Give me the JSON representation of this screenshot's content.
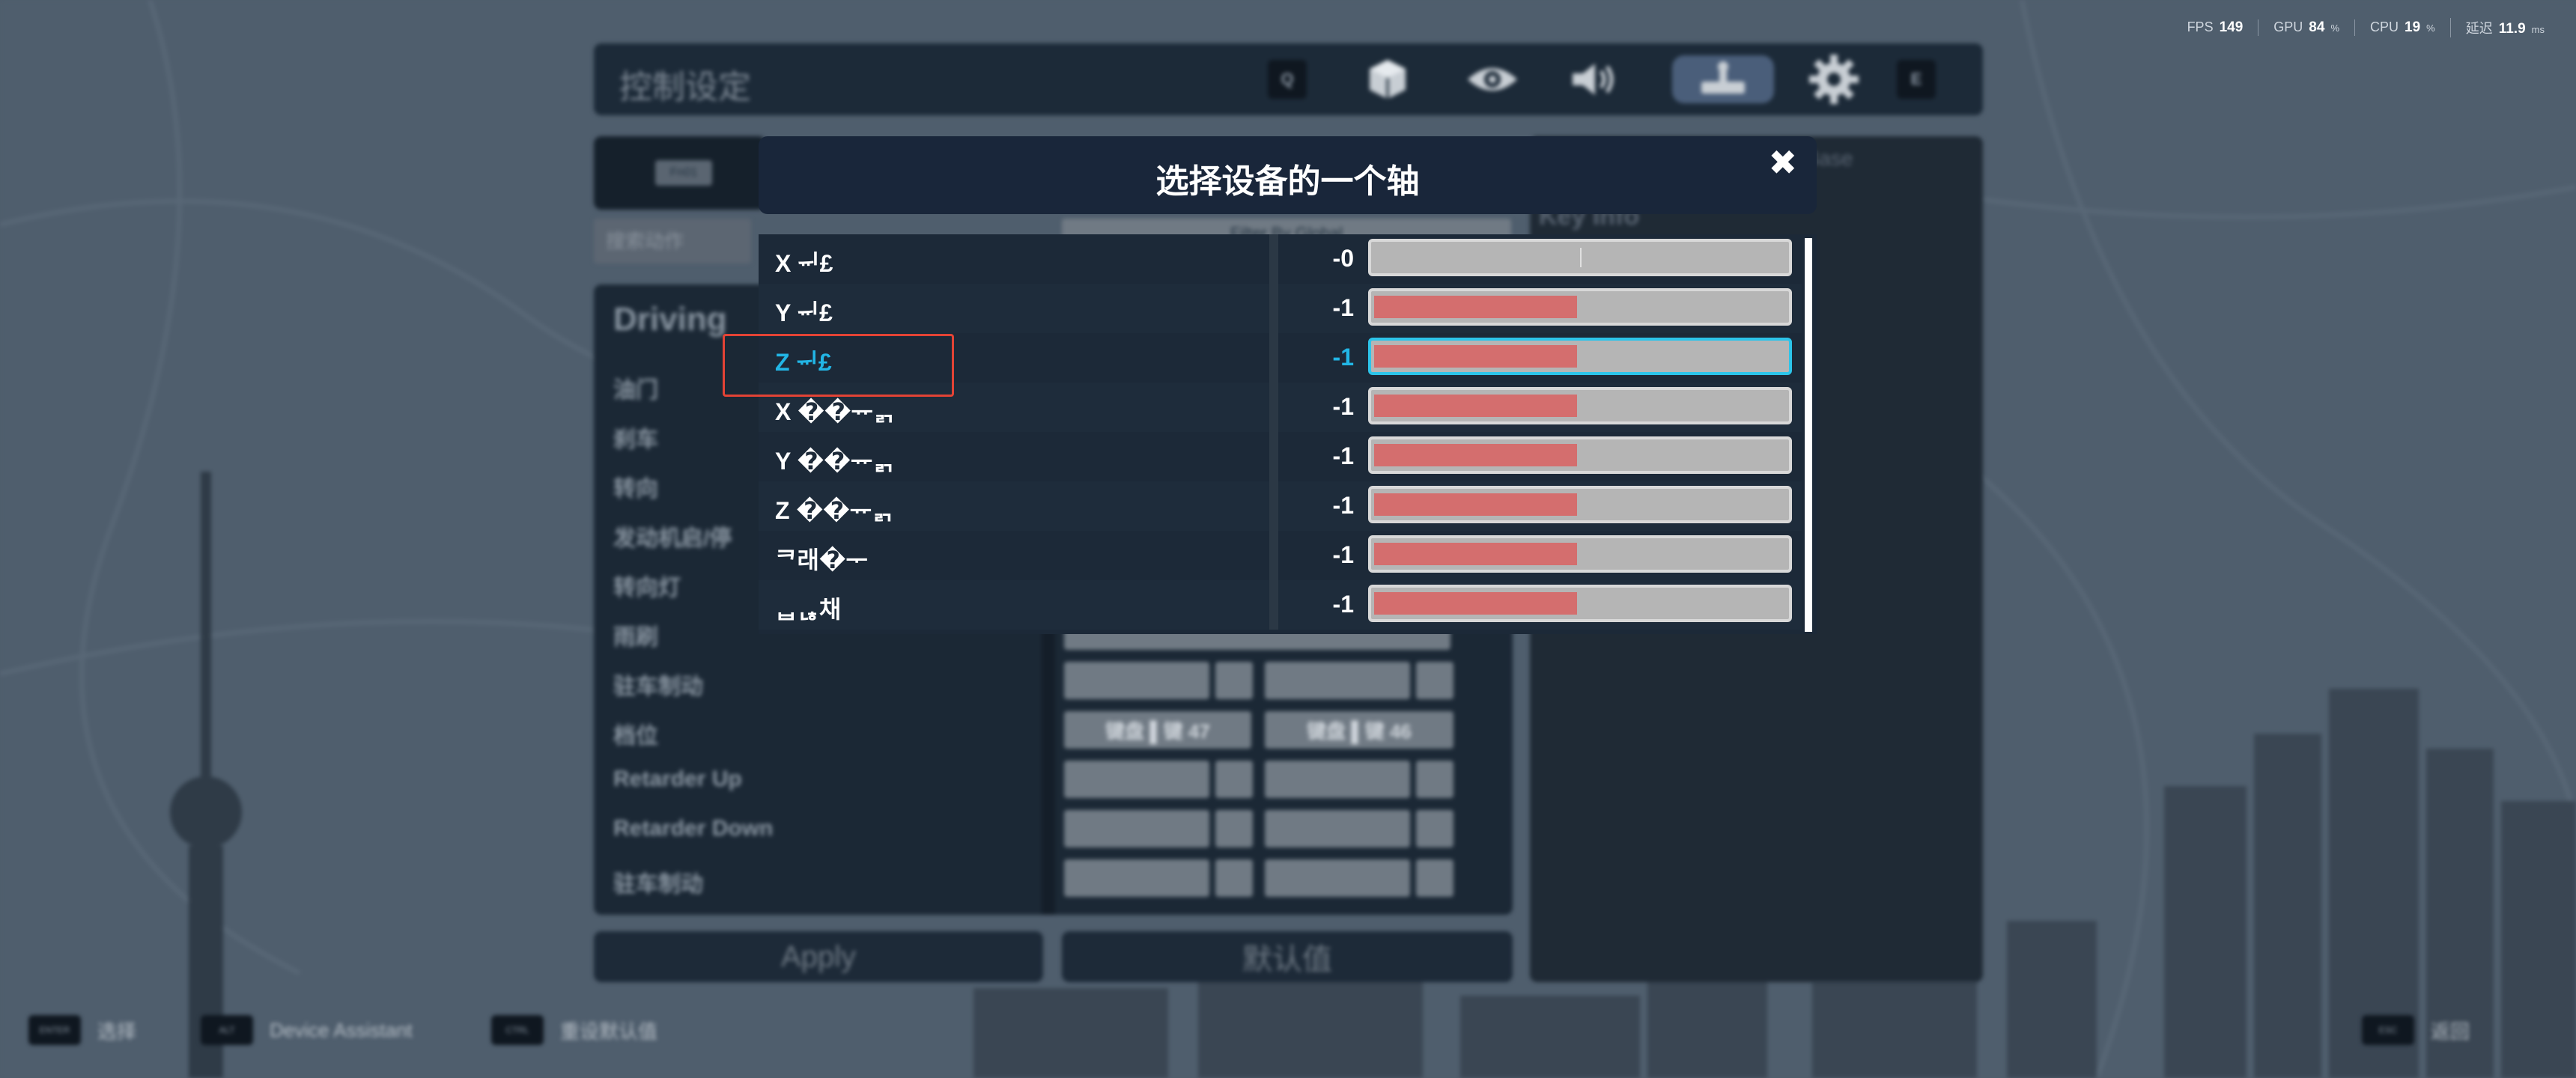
{
  "perf": {
    "fps_label": "FPS",
    "fps_value": "149",
    "gpu_label": "GPU",
    "gpu_value": "84",
    "gpu_unit": "%",
    "cpu_label": "CPU",
    "cpu_value": "19",
    "cpu_unit": "%",
    "latency_label": "延迟",
    "latency_value": "11.9",
    "latency_unit": "ms"
  },
  "topbar": {
    "title": "控制设定",
    "left_key": "Q",
    "right_key": "E",
    "tabs": [
      {
        "icon": "truck-cube-icon",
        "active": false
      },
      {
        "icon": "eye-icon",
        "active": false
      },
      {
        "icon": "speaker-icon",
        "active": false
      },
      {
        "icon": "controller-icon",
        "active": true
      },
      {
        "icon": "gear-icon",
        "active": false
      }
    ]
  },
  "left": {
    "tab_key": "Fn01",
    "filter_placeholder": "搜索动作",
    "filter_top": "Filter By Global",
    "heading": "Driving",
    "actions": [
      {
        "label": "油门"
      },
      {
        "label": "刹车"
      },
      {
        "label": "转向"
      },
      {
        "label": "发动机启/停"
      },
      {
        "label": "转向灯"
      },
      {
        "label": "雨刷"
      },
      {
        "label": "驻车制动"
      },
      {
        "label": "档位",
        "slot1": "键盘 ▌键 47",
        "slot2": "键盘 ▌键 46"
      },
      {
        "label": "Retarder Up"
      },
      {
        "label": "Retarder Down"
      },
      {
        "label": "驻车制动"
      }
    ]
  },
  "right": {
    "base": "Use Base",
    "key_info": "Key Info"
  },
  "buttons": {
    "apply": "Apply",
    "default": "默认值"
  },
  "hints": [
    {
      "key": "ENTER",
      "label": "选择"
    },
    {
      "key": "ALT",
      "label": "Device Assistant"
    },
    {
      "key": "CTRL",
      "label": "重设默认值"
    }
  ],
  "back_hint": {
    "key": "ESC",
    "label": "返回"
  },
  "modal": {
    "title": "选择设备的一个轴",
    "axes": [
      {
        "name": "X ᆔ£",
        "value": "-0",
        "fill": 0.0,
        "selected": false
      },
      {
        "name": "Y ᆔ£",
        "value": "-1",
        "fill": 0.5,
        "selected": false
      },
      {
        "name": "Z ᆔ£",
        "value": "-1",
        "fill": 0.5,
        "selected": true
      },
      {
        "name": "X ��ᅲᆰ",
        "value": "-1",
        "fill": 0.5,
        "selected": false
      },
      {
        "name": "Y ��ᅲᆰ",
        "value": "-1",
        "fill": 0.5,
        "selected": false
      },
      {
        "name": "Z ��ᅲᆰ",
        "value": "-1",
        "fill": 0.5,
        "selected": false
      },
      {
        "name": "ᄏ래�ᅮ",
        "value": "-1",
        "fill": 0.5,
        "selected": false
      },
      {
        "name": "ᆸᆭ채",
        "value": "-1",
        "fill": 0.5,
        "selected": false
      }
    ]
  }
}
